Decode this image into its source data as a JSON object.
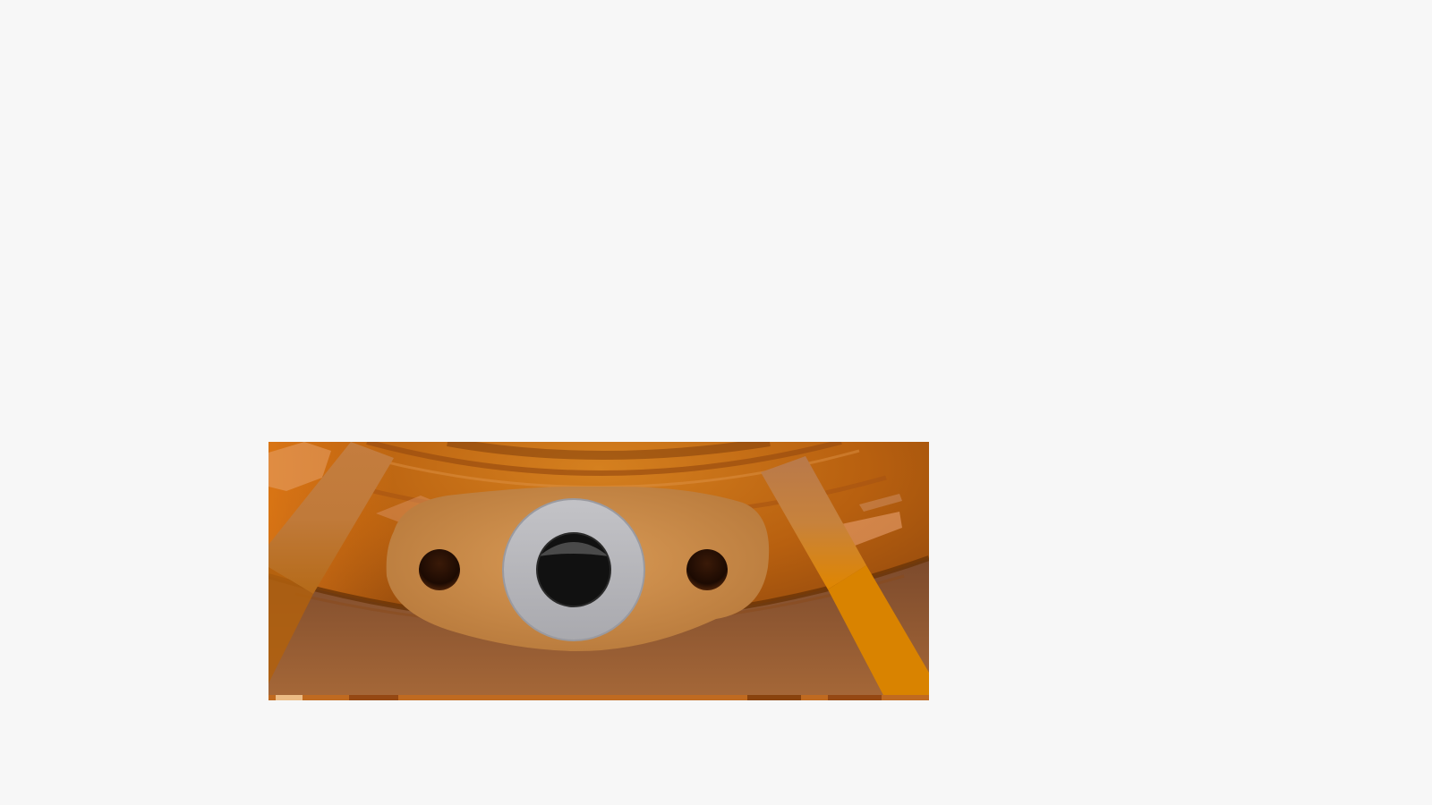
{
  "page": {
    "background": "#f7f7f7"
  },
  "render": {
    "subject": "3d-render-flange",
    "colors": {
      "body_orange": "#c87020",
      "dark_orange": "#8a420c",
      "flange": "#c98a48",
      "washer": "#b4b4b8",
      "hole": "#111111",
      "strut": "#c07a3a",
      "strut_bright": "#e08a00"
    }
  }
}
